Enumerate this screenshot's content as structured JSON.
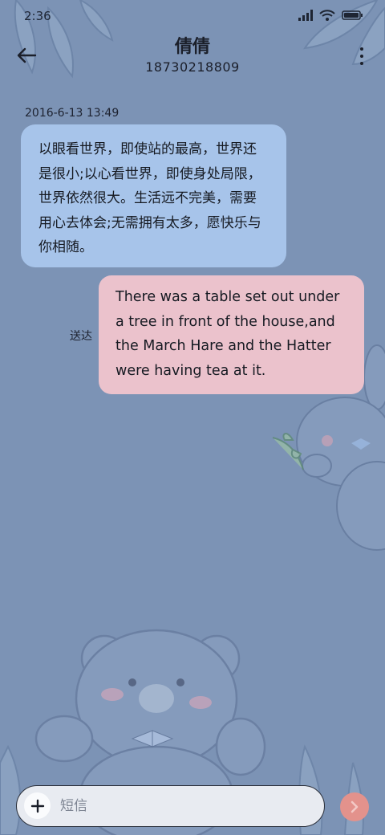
{
  "status_bar": {
    "time": "2:36"
  },
  "header": {
    "contact_name": "倩倩",
    "contact_number": "18730218809"
  },
  "conversation": {
    "timestamp": "2016-6-13 13:49",
    "incoming_message": "以眼看世界，即使站的最高，世界还是很小;以心看世界，即使身处局限，世界依然很大。生活远不完美，需要用心去体会;无需拥有太多，愿快乐与你相随。",
    "outgoing_message": "There was a table set out under a tree in front of the house,and the March Hare and the Hatter were having tea at it.",
    "delivery_status": "送达"
  },
  "composer": {
    "placeholder": "短信",
    "value": ""
  },
  "colors": {
    "background": "#7c93b5",
    "incoming_bubble": "#a7c4ea",
    "outgoing_bubble": "#ebc2cc",
    "send_button": "#e3928c"
  },
  "icons": {
    "back": "arrow-left-icon",
    "more": "more-vertical-icon",
    "attach": "plus-icon",
    "send": "chevron-right-icon",
    "signal": "signal-icon",
    "wifi": "wifi-icon",
    "battery": "battery-icon"
  }
}
